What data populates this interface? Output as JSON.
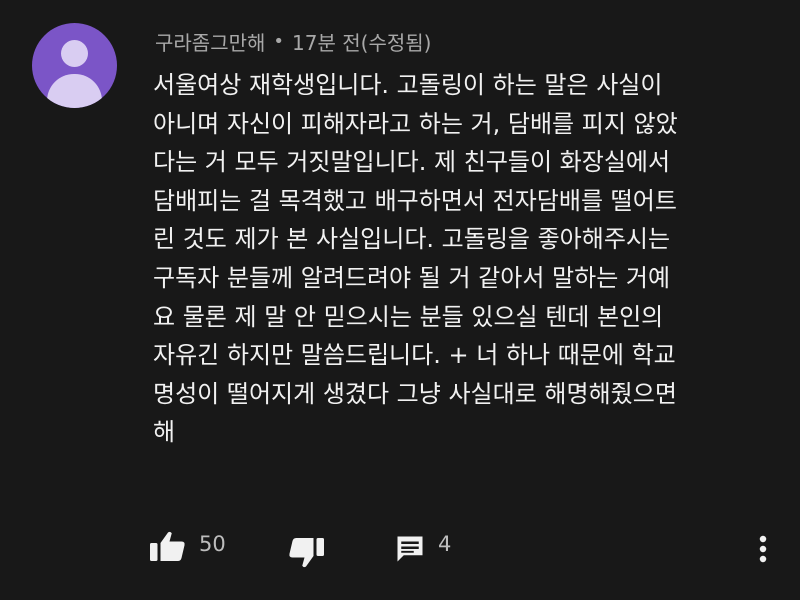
{
  "comment": {
    "author": "구라좀그만해",
    "separator": "•",
    "time": "17분 전(수정됨)",
    "text_lines": [
      "서울여상 재학생입니다. 고돌링이 하는 말은 사실이",
      "아니며 자신이 피해자라고 하는 거, 담배를 피지 않았",
      "다는 거 모두 거짓말입니다. 제 친구들이 화장실에서",
      "담배피는 걸 목격했고 배구하면서 전자담배를 떨어트",
      "린 것도 제가 본 사실입니다. 고돌링을 좋아해주시는",
      "구독자 분들께 알려드려야 될 거 같아서 말하는 거예",
      "요 물론 제 말 안 믿으시는 분들 있으실 텐데 본인의",
      "자유긴 하지만 말씀드립니다. + 너 하나 때문에 학교",
      "명성이 떨어지게 생겼다 그냥 사실대로 해명해줬으면",
      "해"
    ],
    "likes": "50",
    "replies": "4"
  },
  "icons": {
    "avatar": "default-avatar-icon",
    "like": "thumbs-up-icon",
    "dislike": "thumbs-down-icon",
    "reply": "comment-icon",
    "more": "vertical-ellipsis-icon"
  },
  "colors": {
    "background": "#181818",
    "avatar": "#7b55c7",
    "text": "#f1f1f1",
    "meta": "#a8a8a8"
  }
}
